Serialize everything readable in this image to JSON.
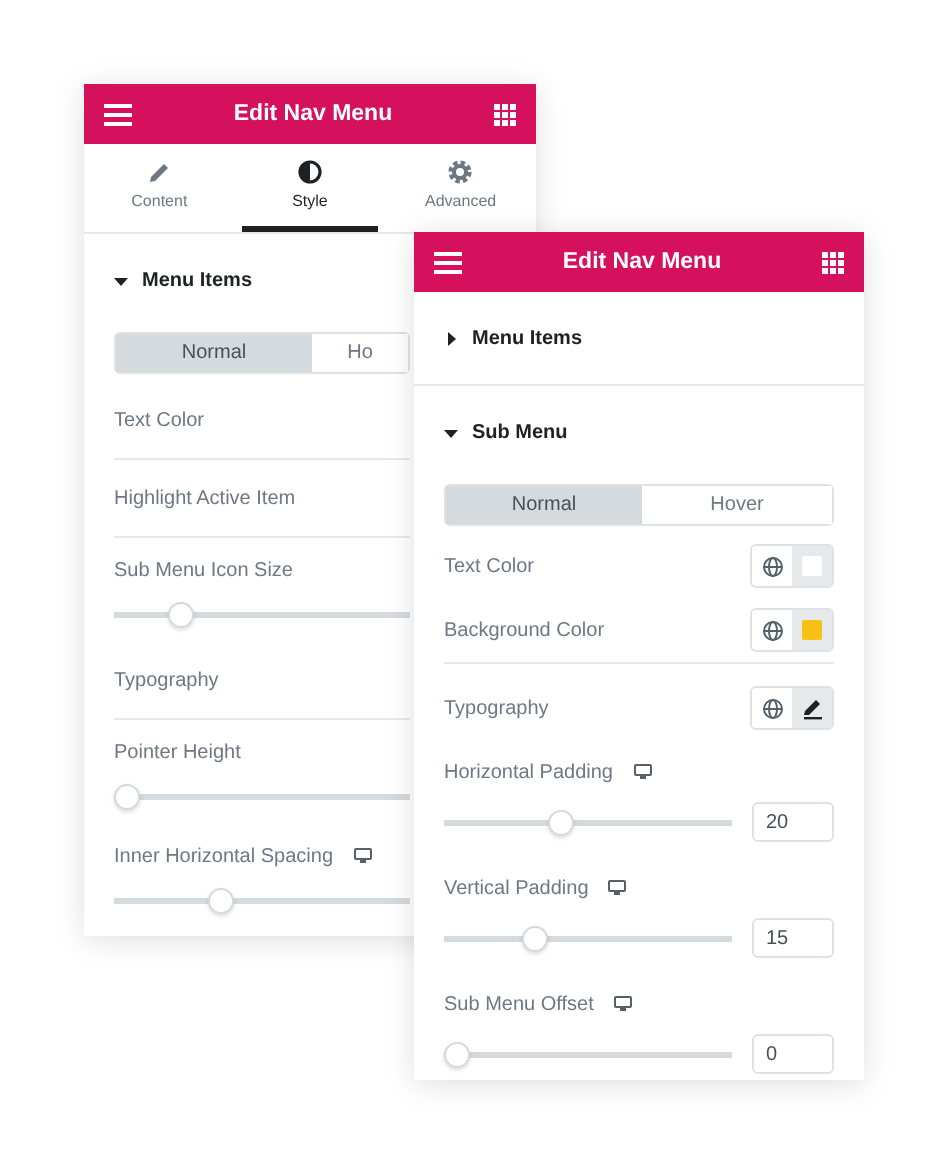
{
  "panels": [
    {
      "title": "Edit Nav Menu",
      "tabs": [
        {
          "label": "Content",
          "kind": "pencil",
          "selected": false
        },
        {
          "label": "Style",
          "kind": "contrast",
          "selected": true
        },
        {
          "label": "Advanced",
          "kind": "gear",
          "selected": false
        }
      ],
      "sections": [
        {
          "title": "Menu Items",
          "expanded": true,
          "state_tabs": [
            {
              "label": "Normal",
              "selected": true
            },
            {
              "label": "Ho",
              "selected": false
            }
          ],
          "controls": [
            {
              "kind": "row",
              "label": "Text Color",
              "divider": true
            },
            {
              "kind": "row",
              "label": "Highlight Active Item",
              "divider": true
            },
            {
              "kind": "slider",
              "label": "Sub Menu Icon Size",
              "responsive": false,
              "level": 0.2
            },
            {
              "kind": "row",
              "label": "Typography",
              "divider": true
            },
            {
              "kind": "slider",
              "label": "Pointer Height",
              "responsive": false,
              "level": 0
            },
            {
              "kind": "slider",
              "label": "Inner Horizontal Spacing",
              "responsive": true,
              "level": 0.35
            }
          ]
        }
      ]
    },
    {
      "title": "Edit Nav Menu",
      "sections": [
        {
          "title": "Menu Items",
          "expanded": false
        },
        {
          "title": "Sub Menu",
          "expanded": true,
          "state_tabs": [
            {
              "label": "Normal",
              "selected": true
            },
            {
              "label": "Hover",
              "selected": false
            }
          ],
          "controls": [
            {
              "kind": "color",
              "label": "Text Color",
              "color": "#ffffff",
              "divider": false
            },
            {
              "kind": "color",
              "label": "Background Color",
              "color": "#f6c015",
              "divider": true
            },
            {
              "kind": "typography",
              "label": "Typography",
              "divider": false
            },
            {
              "kind": "slider",
              "label": "Horizontal Padding",
              "responsive": true,
              "level": 0.4,
              "value": "20"
            },
            {
              "kind": "slider",
              "label": "Vertical Padding",
              "responsive": true,
              "level": 0.3,
              "value": "15"
            },
            {
              "kind": "slider",
              "label": "Sub Menu Offset",
              "responsive": true,
              "level": 0,
              "value": "0"
            }
          ]
        }
      ]
    }
  ]
}
